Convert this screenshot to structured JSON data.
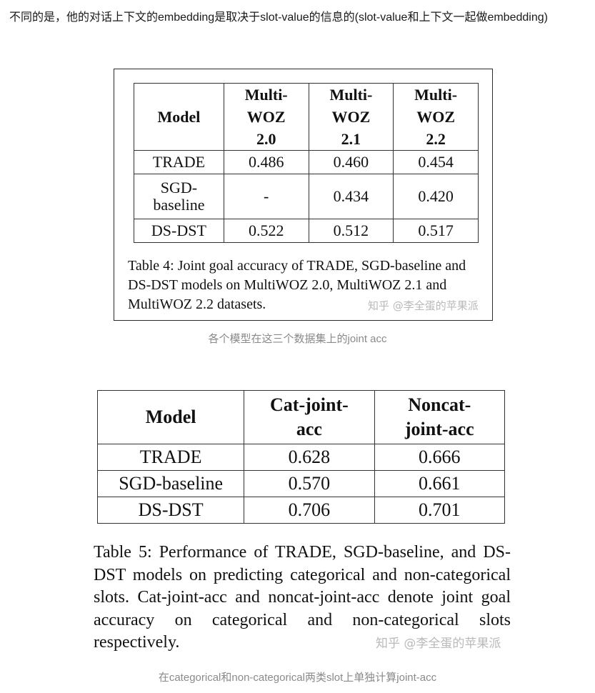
{
  "intro_text": "不同的是，他的对话上下文的embedding是取决于slot-value的信息的(slot-value和上下文一起做embedding)",
  "table4": {
    "headers": [
      "Model",
      "Multi-\nWOZ\n2.0",
      "Multi-\nWOZ\n2.1",
      "Multi-\nWOZ\n2.2"
    ],
    "rows": [
      [
        "TRADE",
        "0.486",
        "0.460",
        "0.454"
      ],
      [
        "SGD-\nbaseline",
        "-",
        "0.434",
        "0.420"
      ],
      [
        "DS-DST",
        "0.522",
        "0.512",
        "0.517"
      ]
    ],
    "caption": "Table 4: Joint goal accuracy of TRADE, SGD-baseline and DS-DST models on MultiWOZ 2.0, MultiWOZ 2.1 and MultiWOZ 2.2 datasets.",
    "watermark": "知乎 @李全蛋的苹果派"
  },
  "caption1": "各个模型在这三个数据集上的joint acc",
  "table5": {
    "headers": [
      "Model",
      "Cat-joint-\nacc",
      "Noncat-\njoint-acc"
    ],
    "rows": [
      [
        "TRADE",
        "0.628",
        "0.666"
      ],
      [
        "SGD-baseline",
        "0.570",
        "0.661"
      ],
      [
        "DS-DST",
        "0.706",
        "0.701"
      ]
    ],
    "caption": "Table 5: Performance of TRADE, SGD-baseline, and DS-DST models on predicting categorical and non-categorical slots. Cat-joint-acc and noncat-joint-acc denote joint goal accuracy on categorical and non-categorical slots respectively.",
    "watermark": "知乎 @李全蛋的苹果派"
  },
  "caption2": "在categorical和non-categorical两类slot上单独计算joint-acc"
}
